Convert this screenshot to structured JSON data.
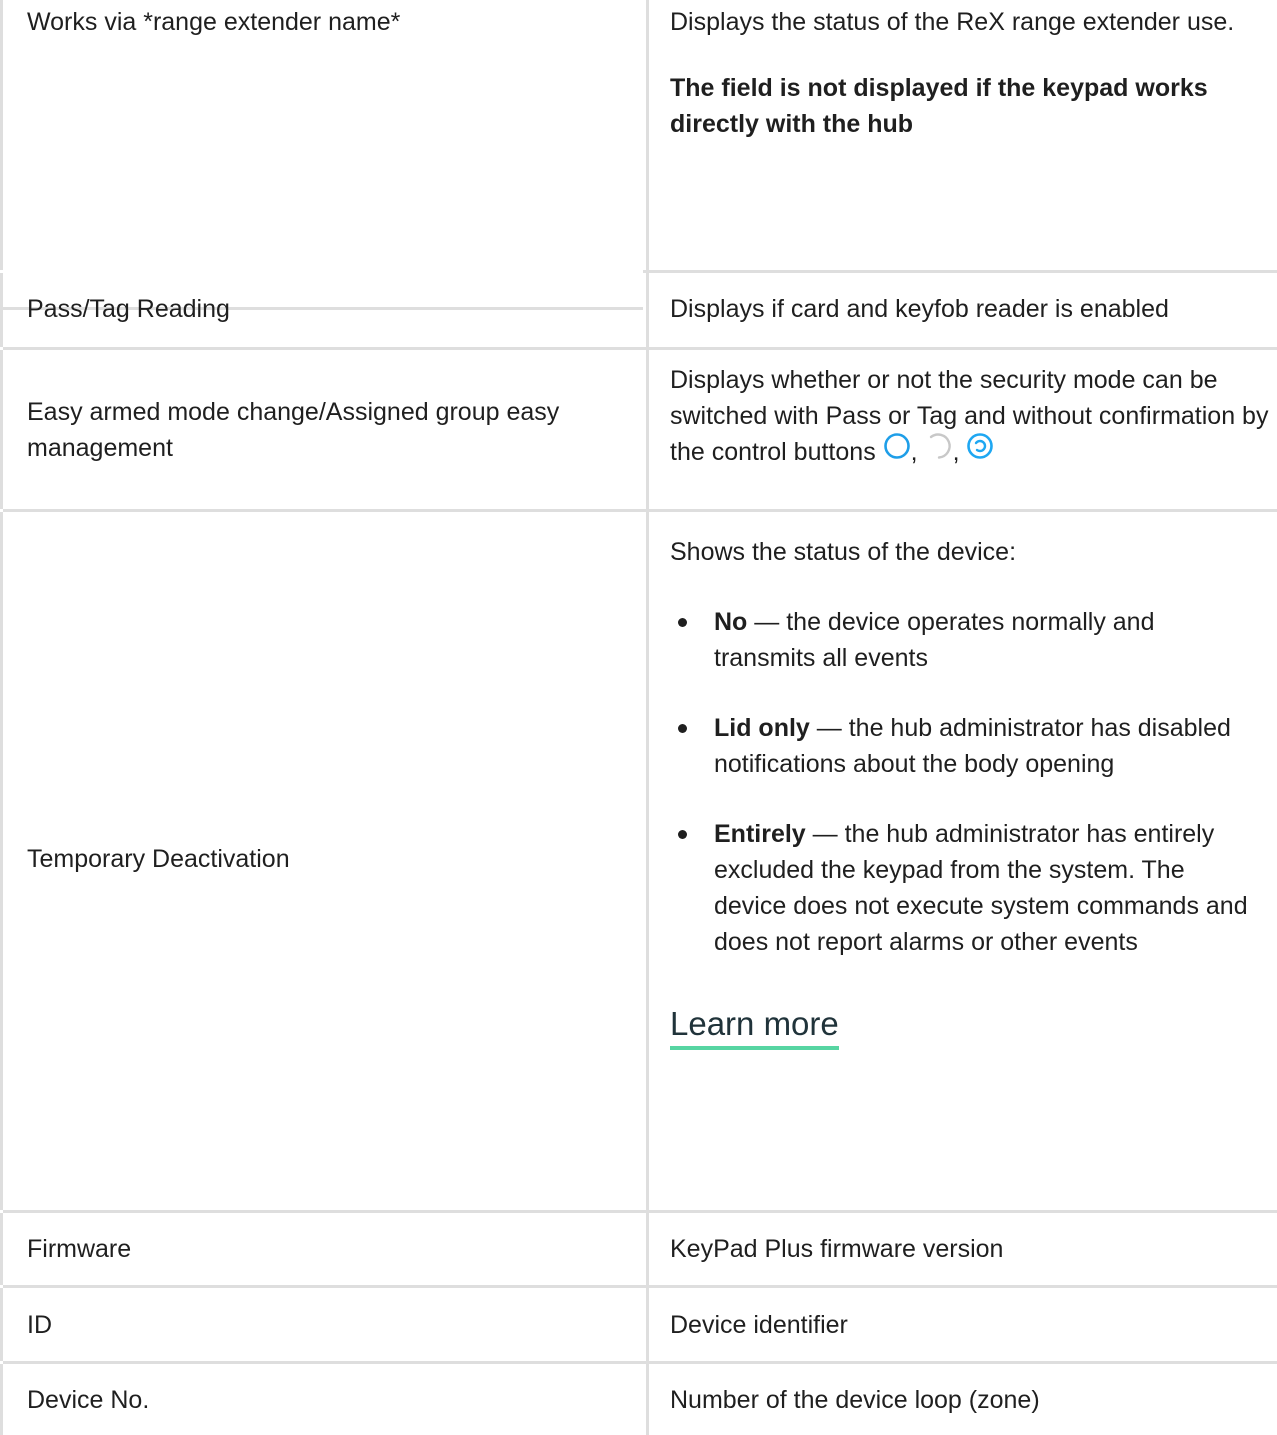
{
  "rows": [
    {
      "name": "Works via *range extender name*",
      "desc": "Displays the status of the ReX range extender use.",
      "note": "The field is not displayed if the keypad works directly with the hub"
    },
    {
      "name": "Pass/Tag Reading",
      "desc": "Displays if card and keyfob reader is enabled"
    },
    {
      "name": "Easy armed mode change/Assigned group easy management",
      "desc": "Displays whether or not the security mode can be switched with Pass or Tag and without confirmation by the control buttons",
      "icons": [
        "arm-button-icon",
        "disarm-button-icon",
        "night-mode-button-icon"
      ],
      "icon_colors": {
        "arm": "#1e9ee8",
        "disarm": "#c8c8c8",
        "night": "#1ea7f2"
      },
      "separator": ","
    },
    {
      "name": "Temporary Deactivation",
      "intro": "Shows the status of the device:",
      "items": [
        {
          "term": "No",
          "text": " — the device operates normally and transmits all events"
        },
        {
          "term": "Lid only",
          "text": " — the hub administrator has disabled notifications about the body opening"
        },
        {
          "term": "Entirely",
          "text": " — the hub administrator has entirely excluded the keypad from the system. The device does not execute system commands and does not report alarms or other events"
        }
      ],
      "link": "Learn more"
    },
    {
      "name": "Firmware",
      "desc": "KeyPad Plus firmware version"
    },
    {
      "name": "ID",
      "desc": "Device identifier"
    },
    {
      "name": "Device No.",
      "desc": "Number of the device loop (zone)"
    }
  ],
  "colors": {
    "border": "#dedede",
    "text": "#1f1f1f",
    "link_underline": "#57d5a2"
  }
}
